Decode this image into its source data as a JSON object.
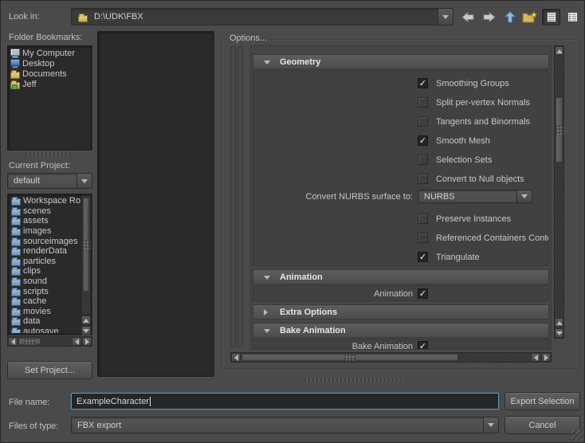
{
  "colors": {
    "dialog_bg": "#4a4a4a",
    "well_bg": "#2a2a2a",
    "focus_blue": "#6793b5",
    "folder_yellow": "#d9b55e",
    "folder_blue": "#7b90ad",
    "nav_up_blue": "#8fb8e0"
  },
  "header": {
    "look_in_label": "Look in:",
    "path_value": "D:\\UDK\\FBX"
  },
  "toolbar": {
    "icons": [
      "back",
      "forward",
      "up",
      "new-folder",
      "list-view",
      "details-view"
    ],
    "active_view": "list-view"
  },
  "bookmarks": {
    "label": "Folder Bookmarks:",
    "items": [
      {
        "icon": "computer-icon",
        "label": "My Computer"
      },
      {
        "icon": "monitor-icon",
        "label": "Desktop"
      },
      {
        "icon": "folder-icon",
        "label": "Documents"
      },
      {
        "icon": "user-folder-icon",
        "label": "Jeff"
      }
    ]
  },
  "project": {
    "label": "Current Project:",
    "value": "default",
    "set_button": "Set Project...",
    "folders": [
      "Workspace Ro",
      "scenes",
      "assets",
      "images",
      "sourceimages",
      "renderData",
      "particles",
      "clips",
      "sound",
      "scripts",
      "cache",
      "movies",
      "data",
      "autosave"
    ]
  },
  "options": {
    "title": "Options...",
    "geometry": {
      "label": "Geometry",
      "expanded": true,
      "checkboxes": [
        {
          "label": "Smoothing Groups",
          "checked": true,
          "mark": "✓"
        },
        {
          "label": "Split per-vertex Normals",
          "checked": false,
          "mark": ""
        },
        {
          "label": "Tangents and Binormals",
          "checked": false,
          "mark": ""
        },
        {
          "label": "Smooth Mesh",
          "checked": true,
          "mark": "✓"
        },
        {
          "label": "Selection Sets",
          "checked": false,
          "mark": ""
        },
        {
          "label": "Convert to Null objects",
          "checked": false,
          "mark": ""
        }
      ],
      "convert_nurbs": {
        "label": "Convert NURBS surface to:",
        "value": "NURBS"
      },
      "checkboxes_after": [
        {
          "label": "Preserve Instances",
          "checked": false,
          "mark": ""
        },
        {
          "label": "Referenced Containers Content",
          "checked": false,
          "mark": ""
        },
        {
          "label": "Triangulate",
          "checked": true,
          "mark": "✓"
        }
      ]
    },
    "animation": {
      "label": "Animation",
      "expanded": true,
      "item": {
        "label": "Animation",
        "checked": true,
        "mark": "✓"
      }
    },
    "extra_options": {
      "label": "Extra Options",
      "expanded": false
    },
    "bake_animation": {
      "label": "Bake Animation",
      "expanded": true,
      "item": {
        "label": "Bake Animation",
        "checked": true,
        "mark": "✓"
      }
    }
  },
  "footer": {
    "file_name_label": "File name:",
    "file_name_value": "ExampleCharacter",
    "files_of_type_label": "Files of type:",
    "files_of_type_value": "FBX export",
    "export_button": "Export Selection",
    "cancel_button": "Cancel"
  }
}
